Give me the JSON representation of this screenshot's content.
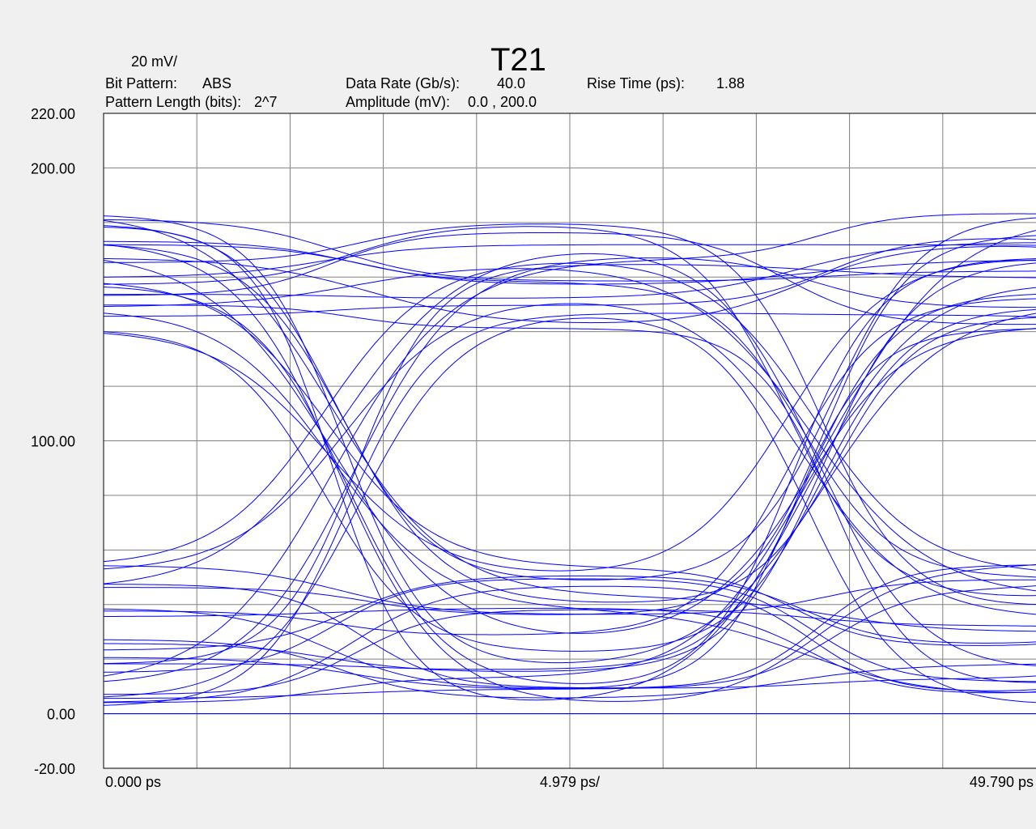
{
  "chart_data": {
    "type": "line",
    "title": "T21",
    "scale_label": "20 mV/",
    "info": {
      "bit_pattern_label": "Bit Pattern:",
      "bit_pattern_value": "ABS",
      "pattern_length_label": "Pattern Length (bits):",
      "pattern_length_value": "2^7",
      "data_rate_label": "Data Rate (Gb/s):",
      "data_rate_value": "40.0",
      "amplitude_label": "Amplitude (mV):",
      "amplitude_value": "0.0 , 200.0",
      "rise_time_label": "Rise Time (ps):",
      "rise_time_value": "1.88"
    },
    "xlabel": "",
    "ylabel": "",
    "x_tick_labels": {
      "left": "0.000 ps",
      "center": "4.979 ps/",
      "right": "49.790 ps"
    },
    "xlim": [
      0,
      49.79
    ],
    "ylim": [
      -20,
      220
    ],
    "y_ticks": [
      {
        "value": 220,
        "label": "220.00"
      },
      {
        "value": 200,
        "label": "200.00"
      },
      {
        "value": 100,
        "label": "100.00"
      },
      {
        "value": 0,
        "label": "0.00"
      },
      {
        "value": -20,
        "label": "-20.00"
      }
    ],
    "grid": true,
    "grid_divisions_x": 10,
    "grid_divisions_y": 12,
    "eye": {
      "bit_period_ps": 25,
      "crossing_times_ps": [
        12.9,
        37.8
      ],
      "crossing_level_mV": 100,
      "high_level_range_mV": [
        141,
        184
      ],
      "low_level_range_mV": [
        0,
        55
      ],
      "trace_count": 48
    },
    "trace_color": "#0000ff",
    "grid_color": "#808080"
  }
}
